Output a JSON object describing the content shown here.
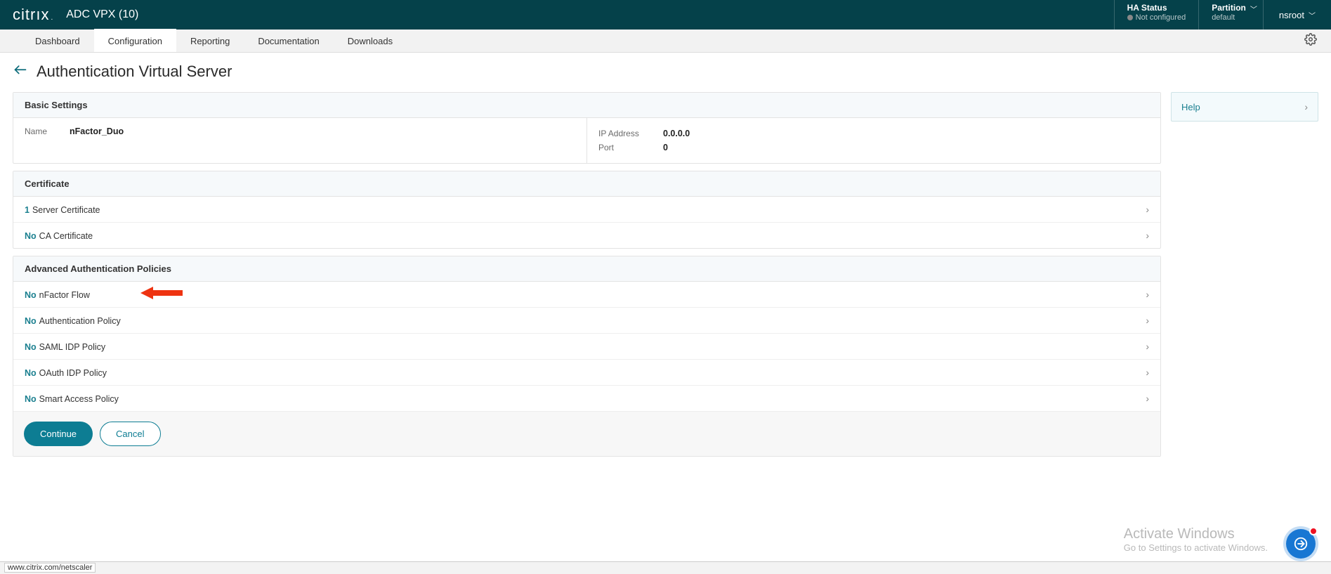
{
  "header": {
    "brand": "citrıx",
    "brand_dot": ".",
    "product": "ADC VPX (10)",
    "ha_title": "HA Status",
    "ha_sub": "Not configured",
    "partition_title": "Partition",
    "partition_value": "default",
    "user": "nsroot"
  },
  "tabs": {
    "items": [
      {
        "label": "Dashboard"
      },
      {
        "label": "Configuration"
      },
      {
        "label": "Reporting"
      },
      {
        "label": "Documentation"
      },
      {
        "label": "Downloads"
      }
    ],
    "active_index": 1
  },
  "page": {
    "title": "Authentication Virtual Server"
  },
  "basic": {
    "header": "Basic Settings",
    "name_label": "Name",
    "name_value": "nFactor_Duo",
    "ip_label": "IP Address",
    "ip_value": "0.0.0.0",
    "port_label": "Port",
    "port_value": "0"
  },
  "certificate": {
    "header": "Certificate",
    "rows": [
      {
        "count": "1",
        "text": "Server Certificate"
      },
      {
        "count": "No",
        "text": "CA Certificate"
      }
    ]
  },
  "policies": {
    "header": "Advanced Authentication Policies",
    "rows": [
      {
        "count": "No",
        "text": "nFactor Flow"
      },
      {
        "count": "No",
        "text": "Authentication Policy"
      },
      {
        "count": "No",
        "text": "SAML IDP Policy"
      },
      {
        "count": "No",
        "text": "OAuth IDP Policy"
      },
      {
        "count": "No",
        "text": "Smart Access Policy"
      }
    ]
  },
  "help": {
    "label": "Help"
  },
  "buttons": {
    "continue": "Continue",
    "cancel": "Cancel"
  },
  "watermark": {
    "t1": "Activate Windows",
    "t2": "Go to Settings to activate Windows."
  },
  "statusbar": {
    "url": "www.citrix.com/netscaler"
  }
}
